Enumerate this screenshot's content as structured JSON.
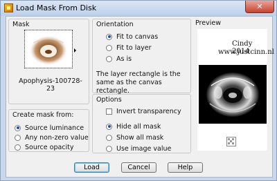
{
  "window": {
    "title": "Load Mask From Disk",
    "close_label": "✕"
  },
  "mask": {
    "group_title": "Mask",
    "filename": "Apophysis-100728-23"
  },
  "create_mask": {
    "group_title": "Create mask from:",
    "options": [
      {
        "label": "Source luminance",
        "selected": true
      },
      {
        "label": "Any non-zero value",
        "selected": false
      },
      {
        "label": "Source opacity",
        "selected": false
      }
    ]
  },
  "orientation": {
    "group_title": "Orientation",
    "options": [
      {
        "label": "Fit to canvas",
        "selected": true
      },
      {
        "label": "Fit to layer",
        "selected": false
      },
      {
        "label": "As is",
        "selected": false
      }
    ],
    "description": "The layer rectangle is the same as the canvas rectangle."
  },
  "options": {
    "group_title": "Options",
    "invert_label": "Invert transparency",
    "invert_checked": false,
    "radios": [
      {
        "label": "Hide all mask",
        "selected": true
      },
      {
        "label": "Show all mask",
        "selected": false
      },
      {
        "label": "Use image value",
        "selected": false
      }
    ]
  },
  "preview": {
    "label": "Preview",
    "watermark_line1": "Cindy 2014",
    "watermark_line2": "www.justcinn.nl"
  },
  "buttons": {
    "load": "Load",
    "cancel": "Cancel",
    "help": "Help"
  }
}
